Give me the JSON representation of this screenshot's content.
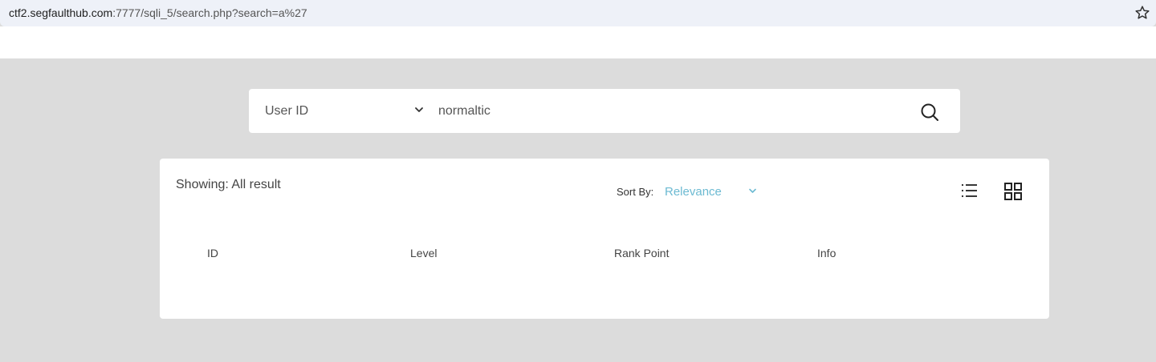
{
  "browser": {
    "url_host": "ctf2.segfaulthub.com",
    "url_rest": ":7777/sqli_5/search.php?search=a%27",
    "bookmark_icon": "star-icon"
  },
  "search": {
    "field_select": "User ID",
    "query": "normaltic",
    "search_icon": "search-icon"
  },
  "results": {
    "showing": "Showing: All result",
    "sort_label": "Sort By:",
    "sort_value": "Relevance",
    "columns": [
      "ID",
      "Level",
      "Rank Point",
      "Info"
    ]
  },
  "colors": {
    "background": "#dcdcdc",
    "accent": "#6cbad2",
    "addressbar": "#eef1f8"
  }
}
